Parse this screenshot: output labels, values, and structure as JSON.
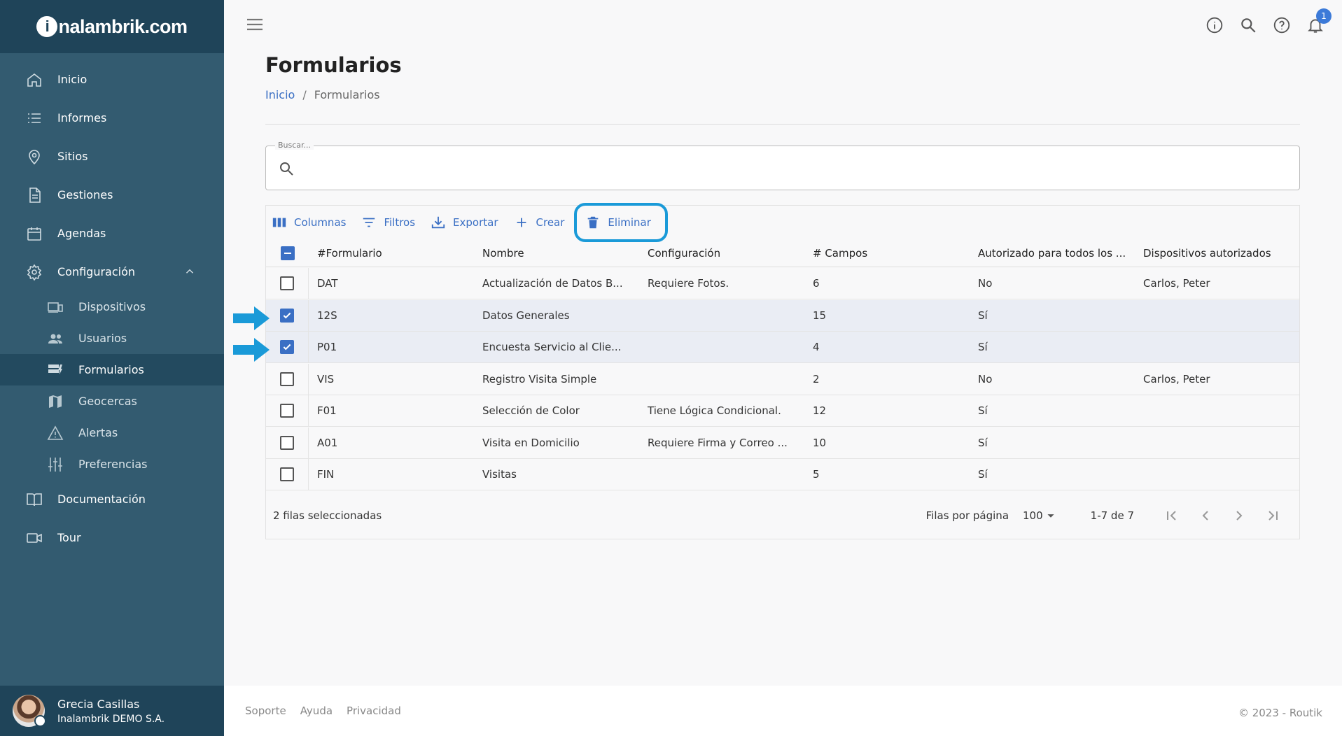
{
  "app": {
    "logo_letter": "i",
    "logo_rest": "nalambrik.com"
  },
  "sidebar": {
    "items": [
      {
        "label": "Inicio"
      },
      {
        "label": "Informes"
      },
      {
        "label": "Sitios"
      },
      {
        "label": "Gestiones"
      },
      {
        "label": "Agendas"
      },
      {
        "label": "Configuración"
      }
    ],
    "sub_items": [
      {
        "label": "Dispositivos"
      },
      {
        "label": "Usuarios"
      },
      {
        "label": "Formularios"
      },
      {
        "label": "Geocercas"
      },
      {
        "label": "Alertas"
      },
      {
        "label": "Preferencias"
      }
    ],
    "bottom_items": [
      {
        "label": "Documentación"
      },
      {
        "label": "Tour"
      }
    ],
    "user": {
      "name": "Grecia Casillas",
      "org": "Inalambrik DEMO S.A."
    }
  },
  "topbar": {
    "notifications_count": "1"
  },
  "page": {
    "title": "Formularios",
    "breadcrumb": {
      "home": "Inicio",
      "sep": "/",
      "current": "Formularios"
    }
  },
  "search": {
    "label": "Buscar...",
    "value": "",
    "placeholder": ""
  },
  "toolbar": {
    "columns": "Columnas",
    "filters": "Filtros",
    "export": "Exportar",
    "create": "Crear",
    "delete": "Eliminar"
  },
  "table": {
    "headers": [
      "#Formulario",
      "Nombre",
      "Configuración",
      "# Campos",
      "Autorizado para todos los ...",
      "Dispositivos autorizados"
    ],
    "rows": [
      {
        "selected": false,
        "id": "DAT",
        "name": "Actualización de Datos B...",
        "config": "Requiere Fotos.",
        "fields": "6",
        "all": "No",
        "devices": "Carlos, Peter"
      },
      {
        "selected": true,
        "id": "12S",
        "name": "Datos Generales",
        "config": "",
        "fields": "15",
        "all": "Sí",
        "devices": ""
      },
      {
        "selected": true,
        "id": "P01",
        "name": "Encuesta Servicio al Clie...",
        "config": "",
        "fields": "4",
        "all": "Sí",
        "devices": ""
      },
      {
        "selected": false,
        "id": "VIS",
        "name": "Registro Visita Simple",
        "config": "",
        "fields": "2",
        "all": "No",
        "devices": "Carlos, Peter"
      },
      {
        "selected": false,
        "id": "F01",
        "name": "Selección de Color",
        "config": "Tiene Lógica Condicional.",
        "fields": "12",
        "all": "Sí",
        "devices": ""
      },
      {
        "selected": false,
        "id": "A01",
        "name": "Visita en Domicilio",
        "config": "Requiere Firma y Correo ...",
        "fields": "10",
        "all": "Sí",
        "devices": ""
      },
      {
        "selected": false,
        "id": "FIN",
        "name": "Visitas",
        "config": "",
        "fields": "5",
        "all": "Sí",
        "devices": ""
      }
    ],
    "selected_count": "2 filas seleccionadas",
    "rows_per_page_label": "Filas por página",
    "rows_per_page": "100",
    "range": "1-7 de 7"
  },
  "footer": {
    "links": [
      "Soporte",
      "Ayuda",
      "Privacidad"
    ],
    "copyright": "© 2023 - Routik"
  },
  "colors": {
    "sidebar": "#335b70",
    "sidebar_dark": "#1f4459",
    "accent": "#3a6fc4",
    "highlight": "#1a9ad8"
  }
}
